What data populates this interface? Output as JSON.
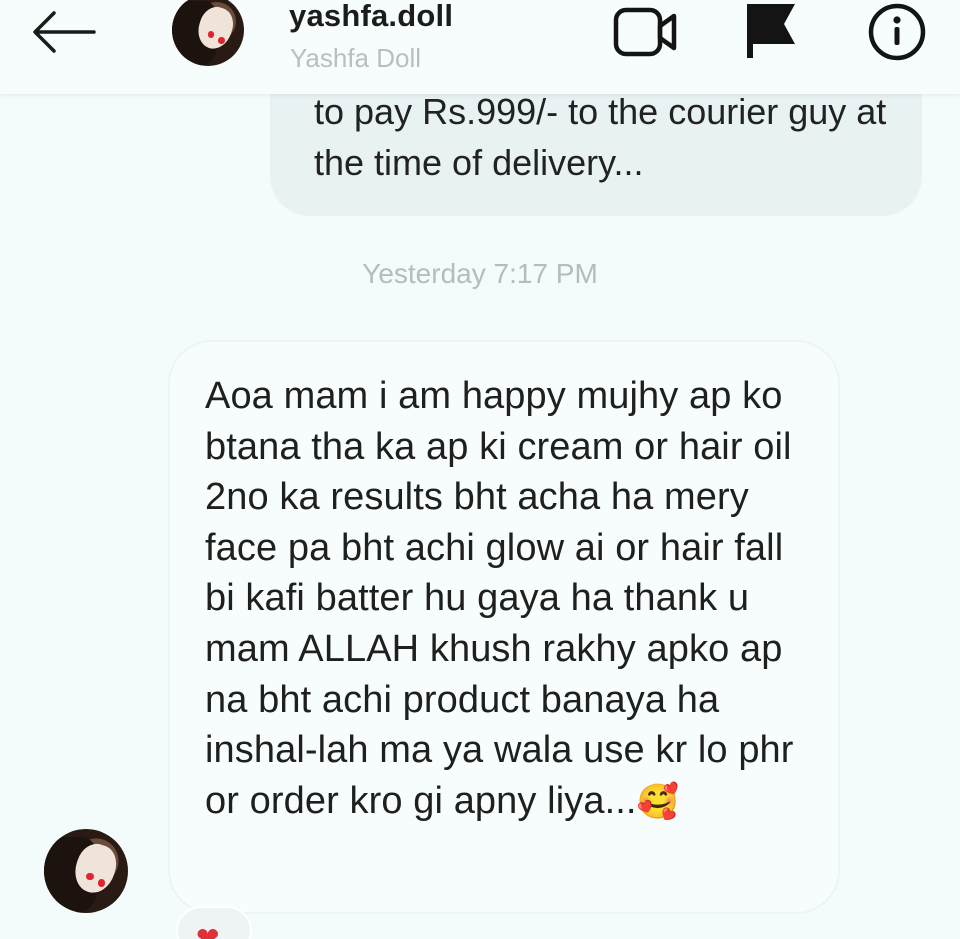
{
  "header": {
    "username": "yashfa.doll",
    "full_name": "Yashfa Doll",
    "back_icon": "arrow-left-icon",
    "video_icon": "video-camera-icon",
    "flag_icon": "flag-icon",
    "info_icon": "info-icon"
  },
  "messages": {
    "sent_text": "to pay Rs.999/- to the courier guy at the time of delivery...",
    "timestamp": "Yesterday 7:17 PM",
    "received_text": "Aoa mam i am happy mujhy ap ko btana tha ka ap ki cream or hair oil 2no ka results bht acha ha mery face pa bht achi glow ai or hair fall bi kafi batter hu gaya ha thank u mam ALLAH khush rakhy apko ap na bht achi product banaya ha inshal-lah ma ya wala use kr lo phr or order kro gi apny liya...",
    "received_emoji": "🥰",
    "reaction_emoji": "❤"
  },
  "colors": {
    "background": "#f4fbfb",
    "sent_bubble": "#e8f2f3",
    "timestamp": "#b6bcbd",
    "reaction_heart": "#e0303a"
  }
}
